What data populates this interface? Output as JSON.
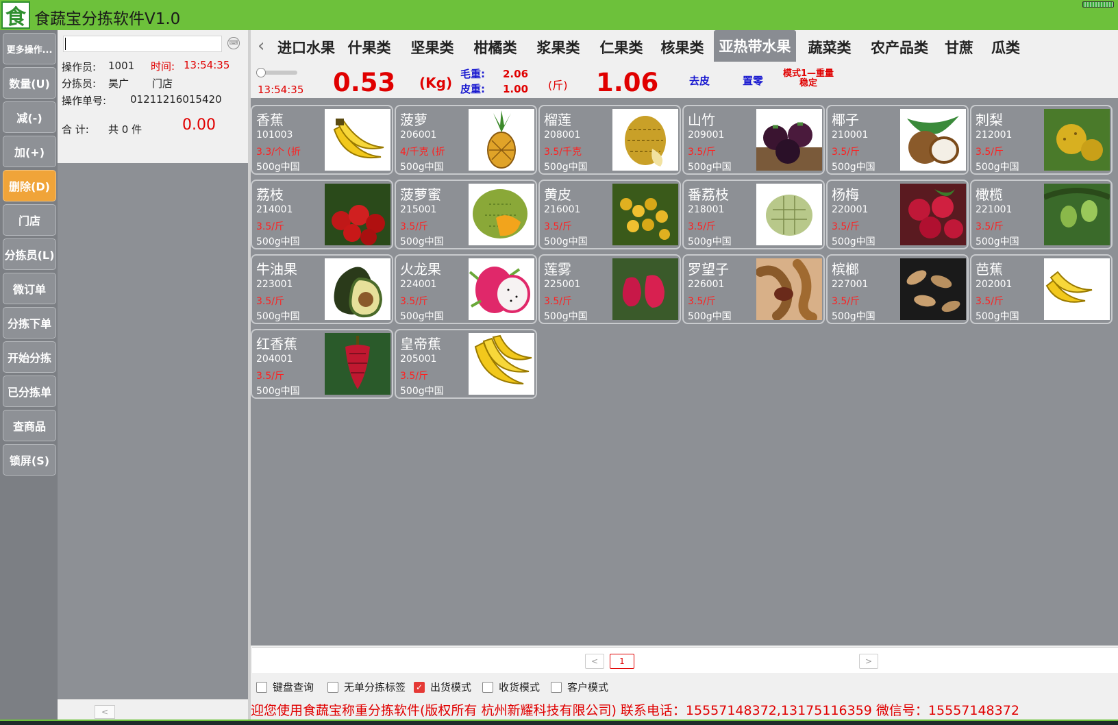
{
  "app": {
    "title": "食蔬宝分拣软件V1.0",
    "logo_char": "食"
  },
  "sidebar": [
    {
      "label": "更多操作..."
    },
    {
      "label": "数量(U)"
    },
    {
      "label": "减(-)"
    },
    {
      "label": "加(+)"
    },
    {
      "label": "删除(D)",
      "active": true
    },
    {
      "label": "门店"
    },
    {
      "label": "分拣员(L)"
    },
    {
      "label": "微订单"
    },
    {
      "label": "分拣下单"
    },
    {
      "label": "开始分拣"
    },
    {
      "label": "已分拣单"
    },
    {
      "label": "查商品"
    },
    {
      "label": "锁屏(S)"
    }
  ],
  "info": {
    "search_value": "",
    "operator_label": "操作员:",
    "operator_id": "1001",
    "time_label": "时间:",
    "time_value": "13:54:35",
    "sorter_label": "分拣员:",
    "sorter_name": "昊广",
    "store_label": "门店",
    "order_no_label": "操作单号:",
    "order_no": "01211216015420",
    "total_label": "合 计:",
    "total_count": "共 0 件",
    "total_amount": "0.00"
  },
  "categories": [
    {
      "label": "进口水果"
    },
    {
      "label": "什果类"
    },
    {
      "label": "坚果类"
    },
    {
      "label": "柑橘类"
    },
    {
      "label": "浆果类"
    },
    {
      "label": "仁果类"
    },
    {
      "label": "核果类"
    },
    {
      "label": "亚热带水果",
      "active": true
    },
    {
      "label": "蔬菜类"
    },
    {
      "label": "农产品类"
    },
    {
      "label": "甘蔗"
    },
    {
      "label": "瓜类"
    }
  ],
  "weight": {
    "time": "13:54:35",
    "kg_value": "0.53",
    "kg_unit": "(Kg)",
    "gross_label": "毛重:",
    "gross_value": "2.06",
    "tare_label": "皮重:",
    "tare_value": "1.00",
    "jin_unit": "(斤)",
    "jin_value": "1.06",
    "peel_label": "去皮",
    "zero_label": "置零",
    "mode_label": "模式1—重量稳定",
    "slider_level": 0
  },
  "products": [
    {
      "name": "香蕉",
      "code": "101003",
      "price": "3.3/个 (折",
      "spec": "500g中国",
      "icon": "banana-icon"
    },
    {
      "name": "菠萝",
      "code": "206001",
      "price": "4/千克 (折",
      "spec": "500g中国",
      "icon": "pineapple-icon"
    },
    {
      "name": "榴莲",
      "code": "208001",
      "price": "3.5/千克",
      "spec": "500g中国",
      "icon": "durian-icon"
    },
    {
      "name": "山竹",
      "code": "209001",
      "price": "3.5/斤",
      "spec": "500g中国",
      "icon": "mangosteen-icon"
    },
    {
      "name": "椰子",
      "code": "210001",
      "price": "3.5/斤",
      "spec": "500g中国",
      "icon": "coconut-icon"
    },
    {
      "name": "刺梨",
      "code": "212001",
      "price": "3.5/斤",
      "spec": "500g中国",
      "icon": "prickly-pear-icon"
    },
    {
      "name": "荔枝",
      "code": "214001",
      "price": "3.5/斤",
      "spec": "500g中国",
      "icon": "lychee-icon"
    },
    {
      "name": "菠萝蜜",
      "code": "215001",
      "price": "3.5/斤",
      "spec": "500g中国",
      "icon": "jackfruit-icon"
    },
    {
      "name": "黄皮",
      "code": "216001",
      "price": "3.5/斤",
      "spec": "500g中国",
      "icon": "wampee-icon"
    },
    {
      "name": "番荔枝",
      "code": "218001",
      "price": "3.5/斤",
      "spec": "500g中国",
      "icon": "sugar-apple-icon"
    },
    {
      "name": "杨梅",
      "code": "220001",
      "price": "3.5/斤",
      "spec": "500g中国",
      "icon": "bayberry-icon"
    },
    {
      "name": "橄榄",
      "code": "221001",
      "price": "3.5/斤",
      "spec": "500g中国",
      "icon": "olive-icon"
    },
    {
      "name": "牛油果",
      "code": "223001",
      "price": "3.5/斤",
      "spec": "500g中国",
      "icon": "avocado-icon"
    },
    {
      "name": "火龙果",
      "code": "224001",
      "price": "3.5/斤",
      "spec": "500g中国",
      "icon": "dragon-fruit-icon"
    },
    {
      "name": "莲雾",
      "code": "225001",
      "price": "3.5/斤",
      "spec": "500g中国",
      "icon": "wax-apple-icon"
    },
    {
      "name": "罗望子",
      "code": "226001",
      "price": "3.5/斤",
      "spec": "500g中国",
      "icon": "tamarind-icon"
    },
    {
      "name": "槟榔",
      "code": "227001",
      "price": "3.5/斤",
      "spec": "500g中国",
      "icon": "betel-nut-icon"
    },
    {
      "name": "芭蕉",
      "code": "202001",
      "price": "3.5/斤",
      "spec": "500g中国",
      "icon": "plantain-icon"
    },
    {
      "name": "红香蕉",
      "code": "204001",
      "price": "3.5/斤",
      "spec": "500g中国",
      "icon": "red-banana-icon"
    },
    {
      "name": "皇帝蕉",
      "code": "205001",
      "price": "3.5/斤",
      "spec": "500g中国",
      "icon": "emperor-banana-icon"
    }
  ],
  "pager": {
    "prev": "<",
    "current": "1",
    "next": ">"
  },
  "options": [
    {
      "label": "键盘查询",
      "checked": false
    },
    {
      "label": "无单分拣标签",
      "checked": false
    },
    {
      "label": "出货模式",
      "checked": true
    },
    {
      "label": "收货模式",
      "checked": false
    },
    {
      "label": "客户模式",
      "checked": false
    }
  ],
  "ticker": "迎您使用食蔬宝称重分拣软件(版权所有  杭州新耀科技有限公司)  联系电话：15557148372,13175116359  微信号：15557148372",
  "colors": {
    "titlebar": "#6dc13b",
    "accent_red": "#e00000",
    "active_button": "#f0a439",
    "panel_gray": "#8d9095"
  }
}
